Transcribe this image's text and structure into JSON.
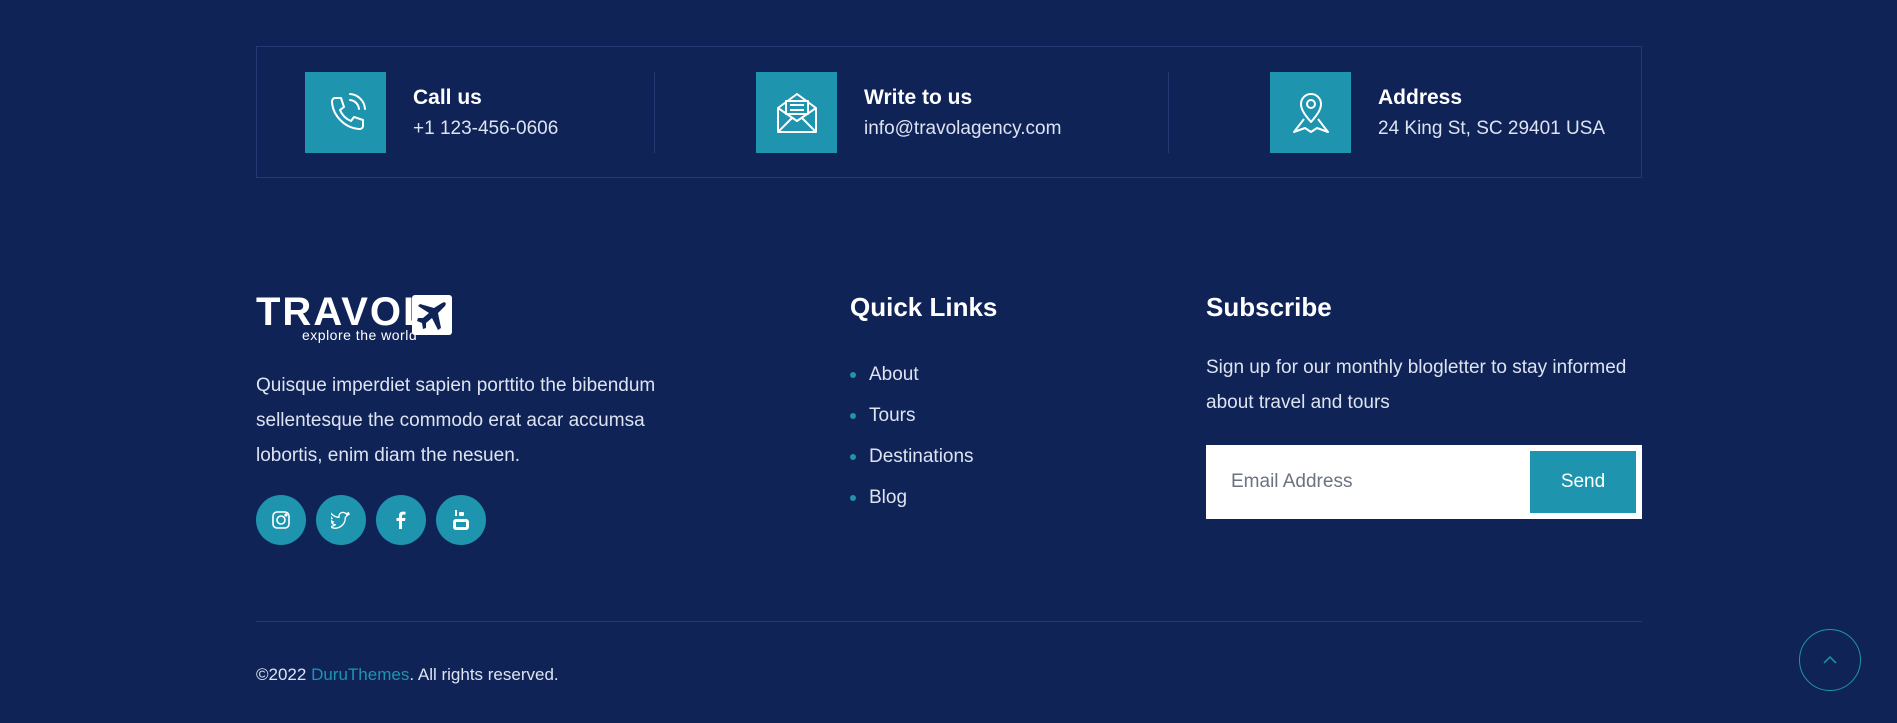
{
  "contact": {
    "call": {
      "title": "Call us",
      "value": "+1 123-456-0606",
      "icon": "phone-icon"
    },
    "write": {
      "title": "Write to us",
      "value": "info@travolagency.com",
      "icon": "mail-icon"
    },
    "address": {
      "title": "Address",
      "value": "24 King St, SC 29401 USA",
      "icon": "map-pin-icon"
    }
  },
  "brand": {
    "name": "TRAVOL",
    "tagline": "explore the world",
    "description": "Quisque imperdiet sapien porttito the bibendum sellentesque the commodo erat acar accumsa lobortis, enim diam the nesuen."
  },
  "socials": [
    {
      "name": "instagram",
      "icon": "instagram-icon"
    },
    {
      "name": "twitter",
      "icon": "twitter-icon"
    },
    {
      "name": "facebook",
      "icon": "facebook-icon"
    },
    {
      "name": "youtube",
      "icon": "youtube-icon"
    }
  ],
  "quick_links": {
    "heading": "Quick Links",
    "items": [
      "About",
      "Tours",
      "Destinations",
      "Blog"
    ]
  },
  "subscribe": {
    "heading": "Subscribe",
    "text": "Sign up for our monthly blogletter to stay informed about travel and tours",
    "placeholder": "Email Address",
    "button": "Send"
  },
  "footer": {
    "copyright_prefix": "©2022 ",
    "company": "DuruThemes",
    "copyright_suffix": ". All rights reserved."
  },
  "colors": {
    "background": "#0f2357",
    "accent": "#1f94ae",
    "divider": "#233a74"
  }
}
